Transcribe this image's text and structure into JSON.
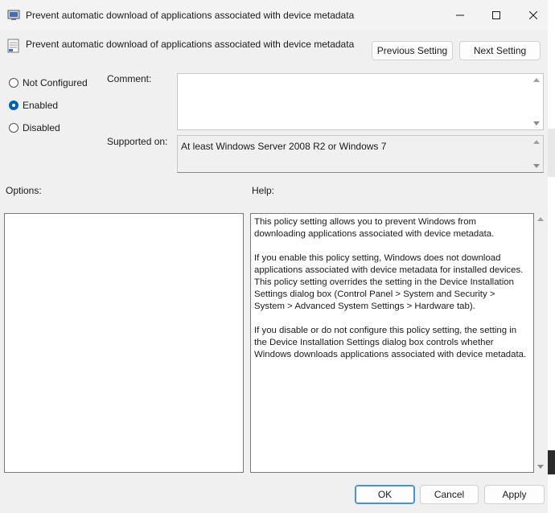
{
  "window": {
    "title": "Prevent automatic download of applications associated with device metadata",
    "app_icon": "policy-setting-icon",
    "controls": {
      "minimize": "minimize-icon",
      "maximize": "maximize-icon",
      "close": "close-icon"
    }
  },
  "header": {
    "title": "Prevent automatic download of applications associated with device metadata",
    "previous_label": "Previous Setting",
    "next_label": "Next Setting"
  },
  "state": {
    "options": [
      {
        "label": "Not Configured",
        "checked": false
      },
      {
        "label": "Enabled",
        "checked": true
      },
      {
        "label": "Disabled",
        "checked": false
      }
    ]
  },
  "comment": {
    "label": "Comment:",
    "value": ""
  },
  "supported": {
    "label": "Supported on:",
    "value": "At least Windows Server 2008 R2 or Windows 7"
  },
  "options_section": {
    "label": "Options:"
  },
  "help": {
    "label": "Help:",
    "paragraphs": [
      "This policy setting allows you to prevent Windows from downloading applications associated with device metadata.",
      "If you enable this policy setting, Windows does not download applications associated with device metadata for installed devices. This policy setting overrides the setting in the Device Installation Settings dialog box (Control Panel > System and Security > System > Advanced System Settings > Hardware tab).",
      "If you disable or do not configure this policy setting, the setting in the Device Installation Settings dialog box controls whether Windows downloads applications associated with device metadata."
    ]
  },
  "footer": {
    "ok_label": "OK",
    "cancel_label": "Cancel",
    "apply_label": "Apply"
  },
  "colors": {
    "accent": "#005fb8",
    "background": "#f0f0f0"
  }
}
